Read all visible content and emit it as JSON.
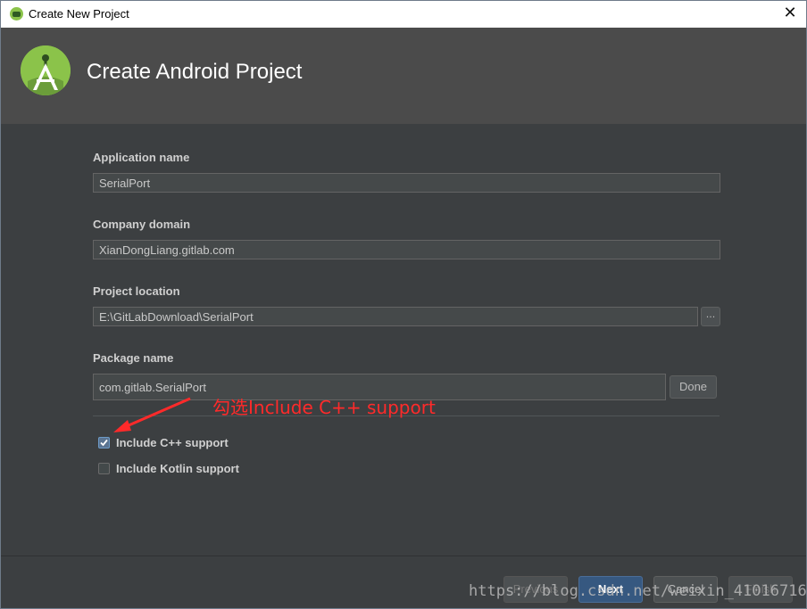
{
  "window": {
    "title": "Create New Project",
    "close_glyph": "✕"
  },
  "header": {
    "title": "Create Android Project",
    "logo_icon": "android-studio-logo"
  },
  "form": {
    "application_name": {
      "label": "Application name",
      "value": "SerialPort"
    },
    "company_domain": {
      "label": "Company domain",
      "value": "XianDongLiang.gitlab.com"
    },
    "project_location": {
      "label": "Project location",
      "value": "E:\\GitLabDownload\\SerialPort",
      "browse_label": "..."
    },
    "package_name": {
      "label": "Package name",
      "value": "com.gitlab.SerialPort",
      "done_label": "Done"
    }
  },
  "options": [
    {
      "label": "Include C++ support",
      "checked": true
    },
    {
      "label": "Include Kotlin support",
      "checked": false
    }
  ],
  "annotation": {
    "text": "勾选Include C++ support",
    "color": "#ff2a2a"
  },
  "footer": {
    "previous_label": "Previous",
    "next_label": "Next",
    "cancel_label": "Cancel",
    "finish_label": "Finish"
  },
  "watermark": "https://blog.csdn.net/weixin_41016716",
  "colors": {
    "background": "#3c3f41",
    "header": "#4b4b4b",
    "accent": "#365880",
    "android_green": "#8bc34a"
  }
}
